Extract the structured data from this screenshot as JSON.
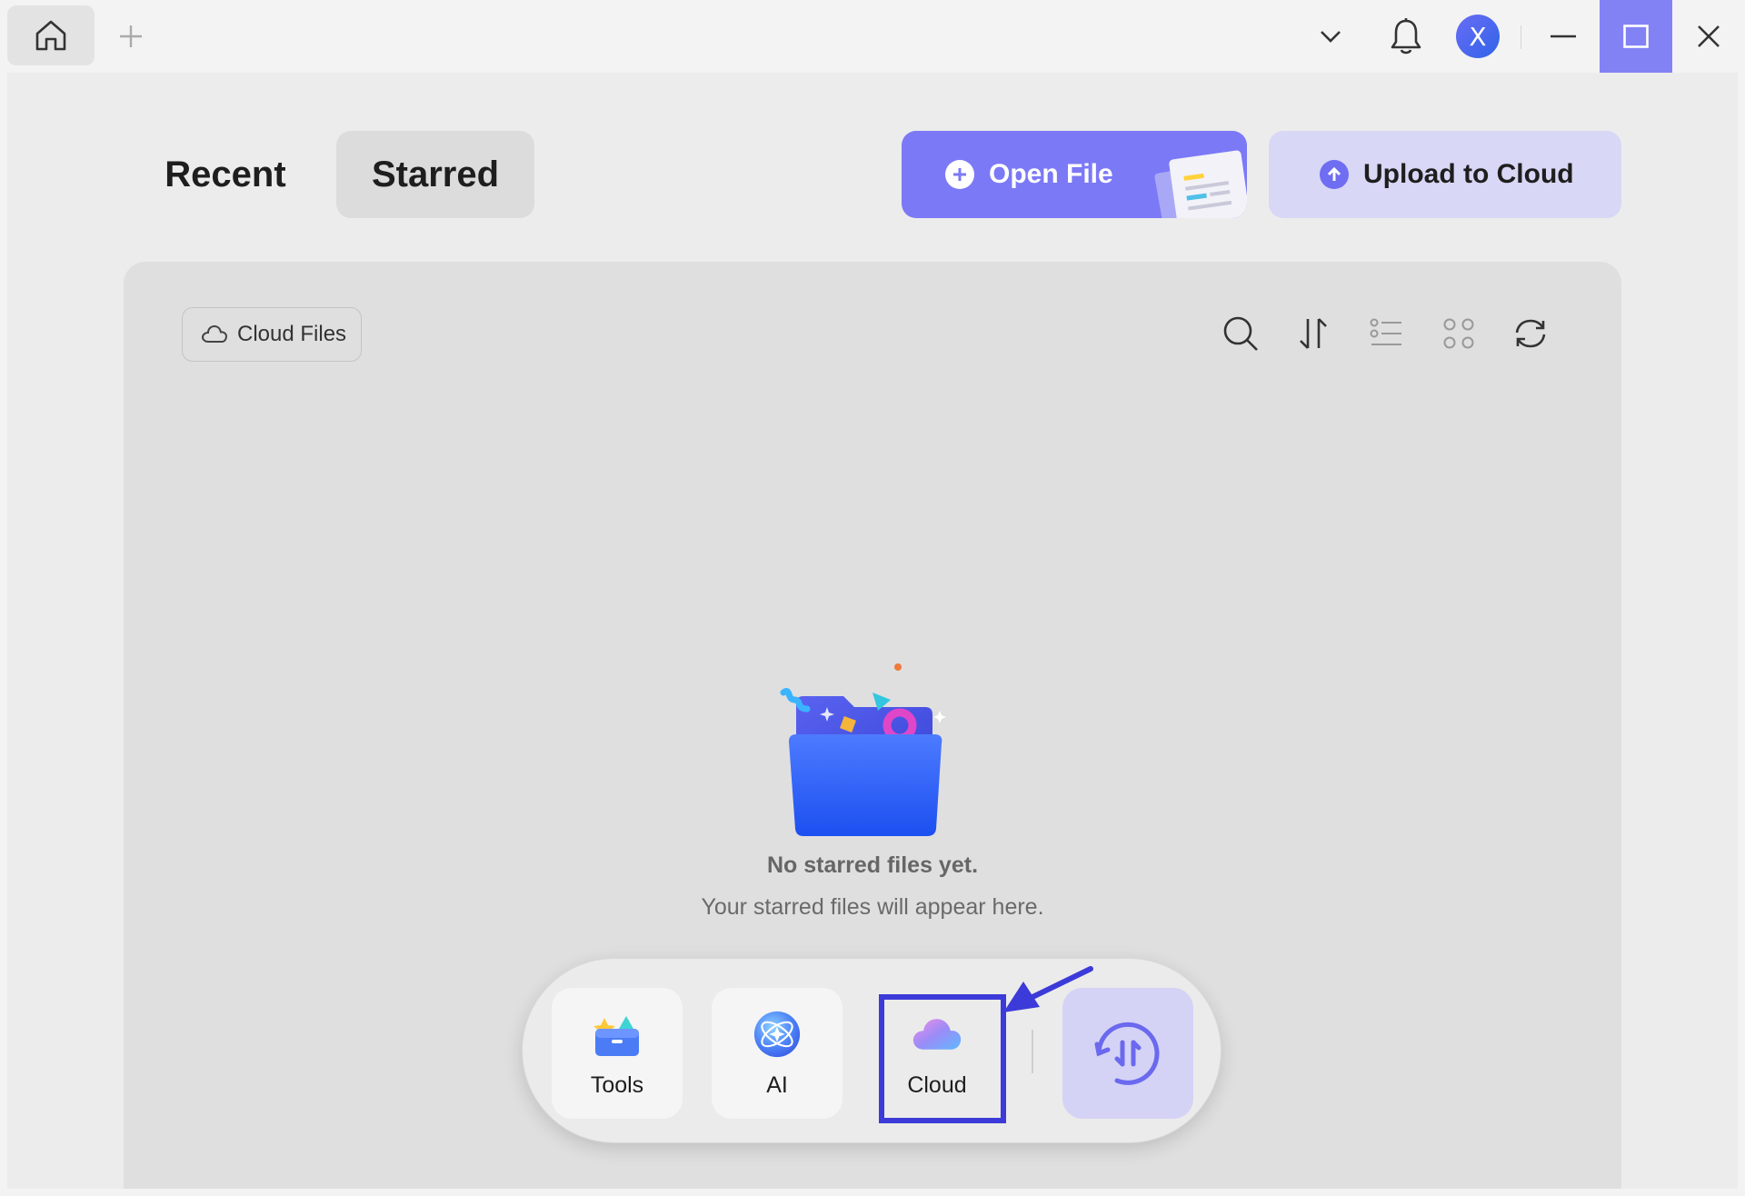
{
  "titlebar": {
    "home_icon": "home-icon",
    "new_tab_icon": "plus-icon",
    "dropdown_icon": "chevron-down-icon",
    "notifications_icon": "bell-icon",
    "avatar_initial": "X",
    "minimize_icon": "minimize-icon",
    "maximize_icon": "maximize-icon",
    "close_icon": "close-icon"
  },
  "tabs": [
    {
      "label": "Recent",
      "active": false
    },
    {
      "label": "Starred",
      "active": true
    }
  ],
  "actions": {
    "open_file_label": "Open File",
    "upload_label": "Upload to Cloud"
  },
  "panel": {
    "cloud_files_label": "Cloud Files",
    "toolbar_icons": [
      "search-icon",
      "sort-icon",
      "list-view-icon",
      "grid-view-icon",
      "refresh-icon"
    ],
    "empty_title": "No starred files yet.",
    "empty_subtitle": "Your starred files will appear here."
  },
  "dock": {
    "items": [
      {
        "label": "Tools",
        "icon": "toolbox-icon"
      },
      {
        "label": "AI",
        "icon": "ai-icon"
      },
      {
        "label": "Cloud",
        "icon": "cloud-icon",
        "highlighted": true
      }
    ],
    "convert_icon": "convert-icon"
  },
  "colors": {
    "accent": "#7b79f6",
    "accent_light": "#d8d7f6",
    "highlight": "#3c3ad8",
    "maximize_bg": "#8382f5"
  }
}
